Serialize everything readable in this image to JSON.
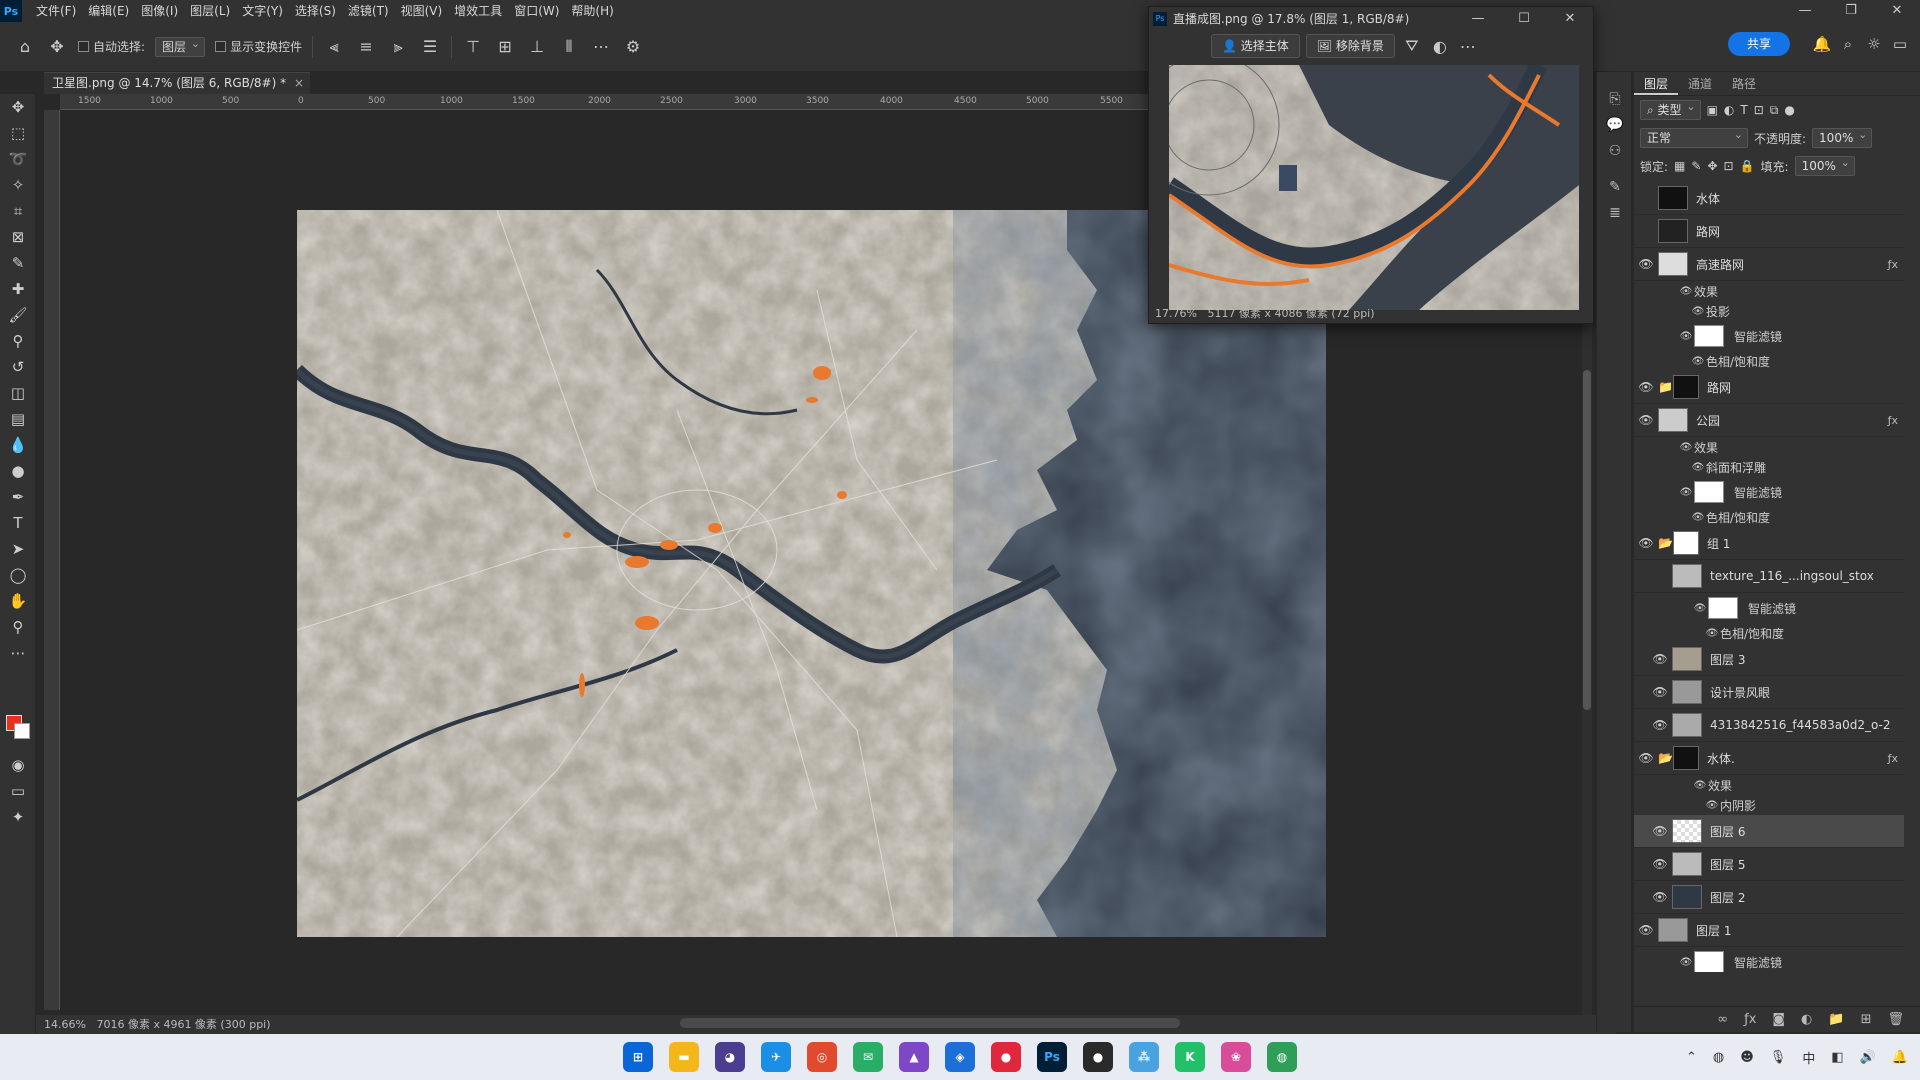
{
  "menubar": {
    "items": [
      "文件(F)",
      "编辑(E)",
      "图像(I)",
      "图层(L)",
      "文字(Y)",
      "选择(S)",
      "滤镜(T)",
      "视图(V)",
      "增效工具",
      "窗口(W)",
      "帮助(H)"
    ]
  },
  "optionsbar": {
    "auto_select_label": "自动选择:",
    "auto_select_target": "图层",
    "show_transform_label": "显示变换控件",
    "share_label": "共享"
  },
  "document": {
    "tab_title": "卫星图.png @ 14.7% (图层 6, RGB/8#) *",
    "zoom": "14.66%",
    "dimensions": "7016 像素 x 4961 像素 (300 ppi)",
    "ruler_ticks": [
      "1500",
      "1000",
      "500",
      "0",
      "500",
      "1000",
      "1500",
      "2000",
      "2500",
      "3000",
      "3500",
      "4000",
      "4500",
      "5000",
      "5500"
    ]
  },
  "navigator": {
    "title": "直播成图.png @ 17.8% (图层 1, RGB/8#)",
    "select_subject": "选择主体",
    "remove_bg": "移除背景",
    "zoom": "17.76%",
    "dimensions": "5117 像素 x 4086 像素 (72 ppi)"
  },
  "layers_panel": {
    "tabs": [
      "图层",
      "通道",
      "路径"
    ],
    "filter_kind": "类型",
    "blend_mode": "正常",
    "opacity_label": "不透明度:",
    "opacity": "100%",
    "lock_label": "锁定:",
    "fill_label": "填充:",
    "fill": "100%",
    "layers": [
      {
        "name": "水体",
        "visible": false
      },
      {
        "name": "路网",
        "visible": false
      },
      {
        "name": "高速路网",
        "visible": true,
        "fx": true
      },
      {
        "name": "路网",
        "visible": true,
        "group": true
      },
      {
        "name": "公园",
        "visible": true,
        "fx": true
      },
      {
        "name": "组 1",
        "visible": true,
        "group": true
      },
      {
        "name": "texture_116_...ingsoul_stox",
        "visible": false
      },
      {
        "name": "图层 3",
        "visible": true
      },
      {
        "name": "设计景风眼",
        "visible": true
      },
      {
        "name": "4313842516_f44583a0d2_o-2",
        "visible": true
      },
      {
        "name": "水体.",
        "visible": true,
        "fx": true
      },
      {
        "name": "图层 6",
        "visible": true,
        "selected": true
      },
      {
        "name": "图层 5",
        "visible": true
      },
      {
        "name": "图层 2",
        "visible": true
      },
      {
        "name": "图层 1",
        "visible": true
      }
    ],
    "subs": {
      "effects": "效果",
      "drop_shadow": "投影",
      "smart_filter": "智能滤镜",
      "hue_sat": "色相/饱和度",
      "bevel": "斜面和浮雕",
      "inner_shadow": "内阴影"
    }
  },
  "colors": {
    "accent": "#1473e6",
    "foreground": "#e8321d",
    "background": "#ffffff",
    "water": "#2f3845",
    "orange": "#e8792e"
  }
}
